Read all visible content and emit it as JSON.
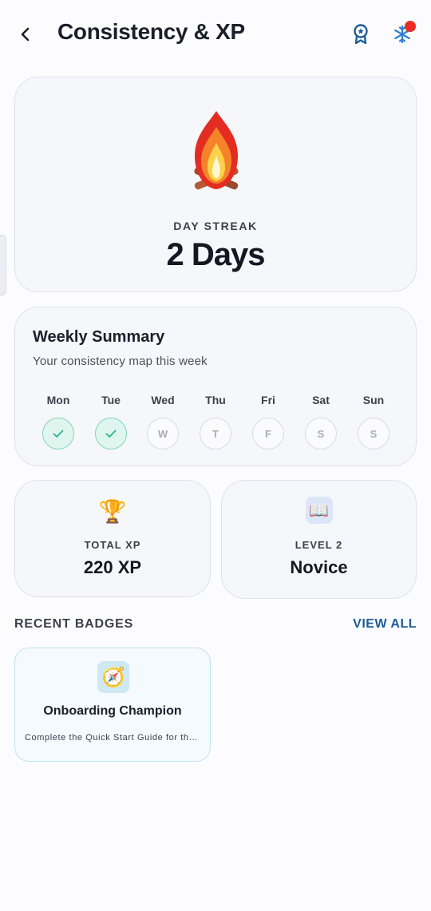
{
  "header": {
    "back_icon": "chevron-left-icon",
    "title": "Consistency & XP",
    "badge_icon": "award-ribbon-icon",
    "freeze_icon": "snowflake-icon"
  },
  "streak": {
    "icon": "campfire-icon",
    "label": "DAY STREAK",
    "value": "2 Days"
  },
  "weekly": {
    "title": "Weekly Summary",
    "subtitle": "Your consistency map this week",
    "days": [
      {
        "name": "Mon",
        "mark": "✓",
        "done": true
      },
      {
        "name": "Tue",
        "mark": "✓",
        "done": true
      },
      {
        "name": "Wed",
        "mark": "W",
        "done": false
      },
      {
        "name": "Thu",
        "mark": "T",
        "done": false
      },
      {
        "name": "Fri",
        "mark": "F",
        "done": false
      },
      {
        "name": "Sat",
        "mark": "S",
        "done": false
      },
      {
        "name": "Sun",
        "mark": "S",
        "done": false
      }
    ]
  },
  "stats": {
    "xp": {
      "icon": "trophy-icon",
      "glyph": "🏆",
      "label": "TOTAL XP",
      "value": "220 XP"
    },
    "level": {
      "icon": "book-icon",
      "glyph": "📖",
      "label": "LEVEL 2",
      "value": "Novice"
    }
  },
  "badges": {
    "section_title": "RECENT BADGES",
    "view_all": "VIEW ALL",
    "items": [
      {
        "icon": "compass-icon",
        "glyph": "🧭",
        "name": "Onboarding Champion",
        "description": "Complete the Quick Start Guide for the ..."
      }
    ]
  },
  "colors": {
    "accent": "#1d5c94",
    "done_fill": "#dff6ef",
    "done_check": "#2bb58a",
    "notification": "#ee2a24"
  }
}
